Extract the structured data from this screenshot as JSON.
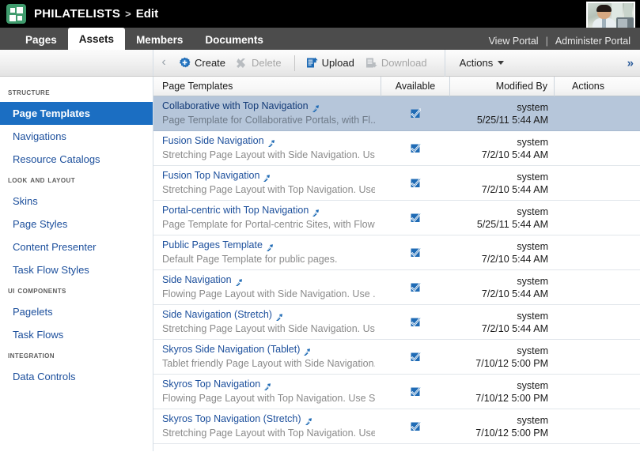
{
  "brand": {
    "logo_icon": "grid-squares-logo-icon",
    "title": "PHILATELISTS",
    "separator": ">",
    "subtitle": "Edit",
    "avatar_icon": "user-avatar-photo"
  },
  "tabs": [
    {
      "label": "Pages",
      "active": false
    },
    {
      "label": "Assets",
      "active": true
    },
    {
      "label": "Members",
      "active": false
    },
    {
      "label": "Documents",
      "active": false
    }
  ],
  "portal_links": {
    "view": "View Portal",
    "pipe": "|",
    "administer": "Administer Portal"
  },
  "toolbar": {
    "back_icon": "chevron-left-icon",
    "create_label": "Create",
    "create_icon": "gear-plus-icon",
    "delete_label": "Delete",
    "delete_icon": "x-close-icon",
    "upload_label": "Upload",
    "upload_icon": "document-upload-icon",
    "download_label": "Download",
    "download_icon": "document-download-icon",
    "actions_label": "Actions",
    "actions_caret_icon": "chevron-down-icon",
    "expand_label": "»",
    "expand_icon": "double-chevron-right-icon"
  },
  "sidebar": {
    "groups": [
      {
        "heading": "STRUCTURE",
        "items": [
          {
            "label": "Page Templates",
            "active": true
          },
          {
            "label": "Navigations",
            "active": false
          },
          {
            "label": "Resource Catalogs",
            "active": false
          }
        ]
      },
      {
        "heading": "LOOK AND LAYOUT",
        "items": [
          {
            "label": "Skins",
            "active": false
          },
          {
            "label": "Page Styles",
            "active": false
          },
          {
            "label": "Content Presenter",
            "active": false
          },
          {
            "label": "Task Flow Styles",
            "active": false
          }
        ]
      },
      {
        "heading": "UI COMPONENTS",
        "items": [
          {
            "label": "Pagelets",
            "active": false
          },
          {
            "label": "Task Flows",
            "active": false
          }
        ]
      },
      {
        "heading": "INTEGRATION",
        "items": [
          {
            "label": "Data Controls",
            "active": false
          }
        ]
      }
    ]
  },
  "table": {
    "columns": {
      "name": "Page Templates",
      "available": "Available",
      "modified_by": "Modified By",
      "actions": "Actions"
    },
    "rows": [
      {
        "title": "Collaborative with Top Navigation",
        "link_icon": "external-link-icon",
        "description": "Page Template for Collaborative Portals, with Fl...",
        "available": true,
        "available_icon": "checked-checkbox-icon",
        "modified_by": "system",
        "modified_date": "5/25/11 5:44 AM",
        "selected": true
      },
      {
        "title": "Fusion Side Navigation",
        "link_icon": "external-link-icon",
        "description": "Stretching Page Layout with Side Navigation. Us...",
        "available": true,
        "available_icon": "checked-checkbox-icon",
        "modified_by": "system",
        "modified_date": "7/2/10 5:44 AM",
        "selected": false
      },
      {
        "title": "Fusion Top Navigation",
        "link_icon": "external-link-icon",
        "description": "Stretching Page Layout with Top Navigation. Use...",
        "available": true,
        "available_icon": "checked-checkbox-icon",
        "modified_by": "system",
        "modified_date": "7/2/10 5:44 AM",
        "selected": false
      },
      {
        "title": "Portal-centric with Top Navigation",
        "link_icon": "external-link-icon",
        "description": "Page Template for Portal-centric Sites, with Flow...",
        "available": true,
        "available_icon": "checked-checkbox-icon",
        "modified_by": "system",
        "modified_date": "5/25/11 5:44 AM",
        "selected": false
      },
      {
        "title": "Public Pages Template",
        "link_icon": "external-link-icon",
        "description": "Default Page Template for public pages.",
        "available": true,
        "available_icon": "checked-checkbox-icon",
        "modified_by": "system",
        "modified_date": "7/2/10 5:44 AM",
        "selected": false
      },
      {
        "title": "Side Navigation",
        "link_icon": "external-link-icon",
        "description": "Flowing Page Layout with Side Navigation. Use ...",
        "available": true,
        "available_icon": "checked-checkbox-icon",
        "modified_by": "system",
        "modified_date": "7/2/10 5:44 AM",
        "selected": false
      },
      {
        "title": "Side Navigation (Stretch)",
        "link_icon": "external-link-icon",
        "description": "Stretching Page Layout with Side Navigation. Us...",
        "available": true,
        "available_icon": "checked-checkbox-icon",
        "modified_by": "system",
        "modified_date": "7/2/10 5:44 AM",
        "selected": false
      },
      {
        "title": "Skyros Side Navigation (Tablet)",
        "link_icon": "external-link-icon",
        "description": "Tablet friendly Page Layout with Side Navigation....",
        "available": true,
        "available_icon": "checked-checkbox-icon",
        "modified_by": "system",
        "modified_date": "7/10/12 5:00 PM",
        "selected": false
      },
      {
        "title": "Skyros Top Navigation",
        "link_icon": "external-link-icon",
        "description": "Flowing Page Layout with Top Navigation. Use S...",
        "available": true,
        "available_icon": "checked-checkbox-icon",
        "modified_by": "system",
        "modified_date": "7/10/12 5:00 PM",
        "selected": false
      },
      {
        "title": "Skyros Top Navigation (Stretch)",
        "link_icon": "external-link-icon",
        "description": "Stretching Page Layout with Top Navigation. Use...",
        "available": true,
        "available_icon": "checked-checkbox-icon",
        "modified_by": "system",
        "modified_date": "7/10/12 5:00 PM",
        "selected": false
      }
    ]
  },
  "colors": {
    "brand_bar": "#000000",
    "tab_bar": "#4c4c4c",
    "logo_green": "#3f9b6d",
    "accent_blue": "#1b6ec2",
    "link_blue": "#1c4f9c",
    "row_selected": "#b6c6da",
    "icon_blue": "#1f6bb5"
  }
}
